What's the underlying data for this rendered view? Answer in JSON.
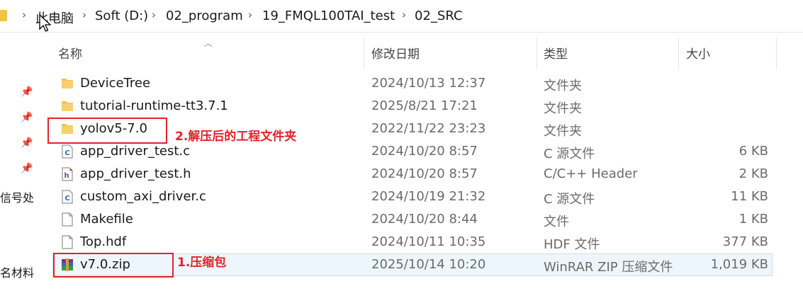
{
  "breadcrumb": {
    "items": [
      "此电脑",
      "Soft (D:)",
      "02_program",
      "19_FMQL100TAI_test",
      "02_SRC"
    ],
    "separator": "›"
  },
  "nav": {
    "labels": [
      "信号处",
      "名材料"
    ]
  },
  "columns": {
    "name": "名称",
    "date": "修改日期",
    "type": "类型",
    "size": "大小"
  },
  "files": [
    {
      "name": "DeviceTree",
      "date": "2024/10/13 12:37",
      "type": "文件夹",
      "size": "",
      "icon": "folder-icon"
    },
    {
      "name": "tutorial-runtime-tt3.7.1",
      "date": "2025/8/21 17:21",
      "type": "文件夹",
      "size": "",
      "icon": "folder-icon"
    },
    {
      "name": "yolov5-7.0",
      "date": "2022/11/22 23:23",
      "type": "文件夹",
      "size": "",
      "icon": "folder-icon"
    },
    {
      "name": "app_driver_test.c",
      "date": "2024/10/20 8:57",
      "type": "C 源文件",
      "size": "6 KB",
      "icon": "c-source-file-icon"
    },
    {
      "name": "app_driver_test.h",
      "date": "2024/10/20 8:57",
      "type": "C/C++ Header",
      "size": "2 KB",
      "icon": "header-file-icon"
    },
    {
      "name": "custom_axi_driver.c",
      "date": "2024/10/19 21:32",
      "type": "C 源文件",
      "size": "11 KB",
      "icon": "c-source-file-icon"
    },
    {
      "name": "Makefile",
      "date": "2024/10/20 8:44",
      "type": "文件",
      "size": "1 KB",
      "icon": "blank-file-icon"
    },
    {
      "name": "Top.hdf",
      "date": "2024/10/11 10:35",
      "type": "HDF 文件",
      "size": "377 KB",
      "icon": "blank-file-icon"
    },
    {
      "name": "v7.0.zip",
      "date": "2025/10/14 10:20",
      "type": "WinRAR ZIP 压缩文件",
      "size": "1,019 KB",
      "icon": "winrar-archive-icon"
    }
  ],
  "annotations": {
    "label_folder": "2.解压后的工程文件夹",
    "label_zip": "1.压缩包"
  },
  "colors": {
    "folder": "#f2c14e",
    "annotation": "#e0242b",
    "selection": "#eef6fd"
  }
}
